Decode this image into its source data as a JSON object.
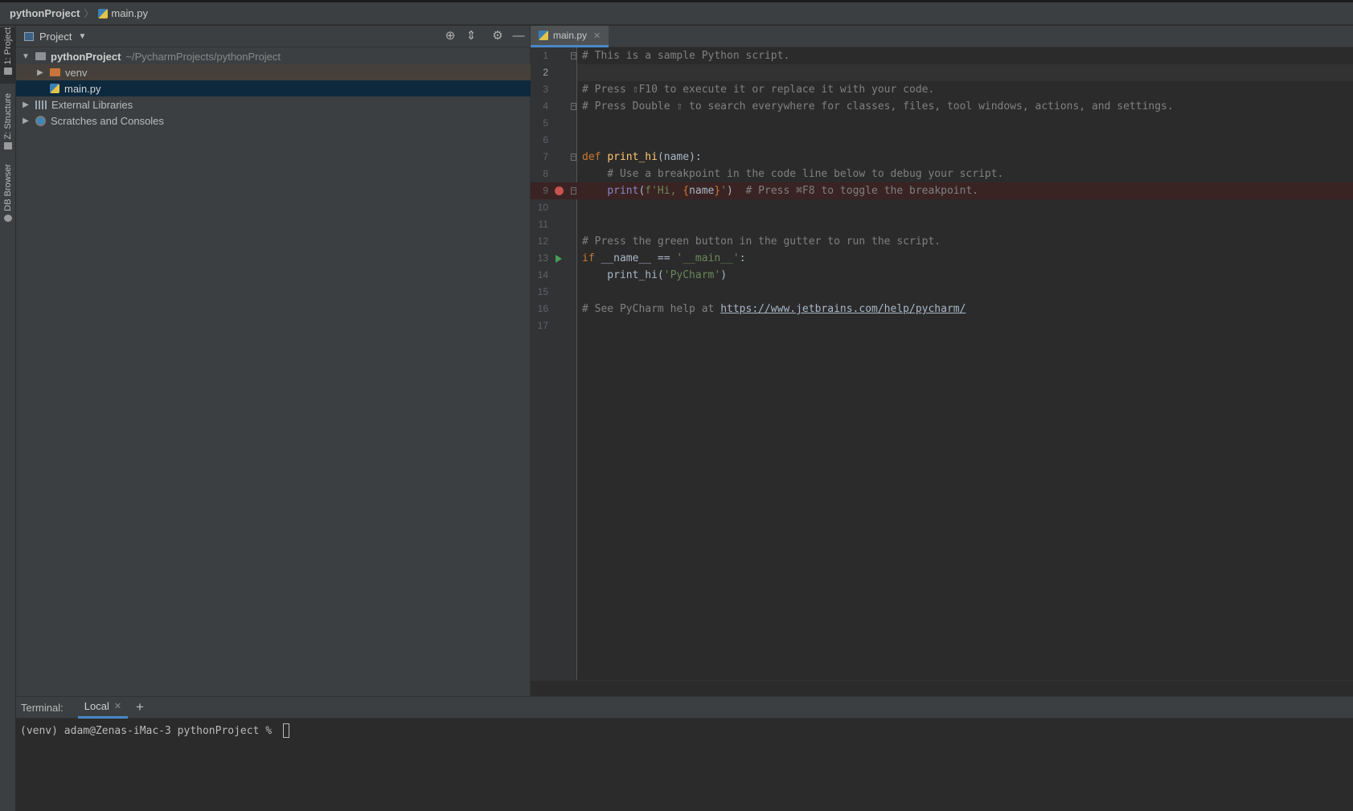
{
  "breadcrumb": {
    "project": "pythonProject",
    "file": "main.py"
  },
  "left_stripe": {
    "tabs": [
      {
        "label": "1: Project",
        "active": true
      },
      {
        "label": "Z: Structure",
        "active": false
      },
      {
        "label": "DB Browser",
        "active": false
      }
    ]
  },
  "project_panel": {
    "title": "Project",
    "tree": [
      {
        "label": "pythonProject",
        "path": "~/PycharmProjects/pythonProject",
        "expanded": true
      },
      {
        "label": "venv",
        "expanded": false
      },
      {
        "label": "main.py",
        "selected": true
      },
      {
        "label": "External Libraries",
        "expanded": false
      },
      {
        "label": "Scratches and Consoles",
        "expanded": false
      }
    ]
  },
  "editor": {
    "tab_label": "main.py",
    "current_line": 2,
    "breakpoint_line": 9,
    "run_marker_line": 13,
    "line_numbers": [
      "1",
      "2",
      "3",
      "4",
      "5",
      "6",
      "7",
      "8",
      "9",
      "10",
      "11",
      "12",
      "13",
      "14",
      "15",
      "16",
      "17"
    ],
    "code": {
      "l1": "# This is a sample Python script.",
      "l3": "# Press ⇧F10 to execute it or replace it with your code.",
      "l4": "# Press Double ⇧ to search everywhere for classes, files, tool windows, actions, and settings.",
      "l7_kw": "def",
      "l7_fn": "print_hi",
      "l7_rest": "(name):",
      "l8": "    # Use a breakpoint in the code line below to debug your script.",
      "l9_indent": "    ",
      "l9_fn": "print",
      "l9_open": "(",
      "l9_str1": "f'Hi, ",
      "l9_brace1": "{",
      "l9_name": "name",
      "l9_brace2": "}",
      "l9_str2": "'",
      "l9_close": ")",
      "l9_comment": "  # Press ⌘F8 to toggle the breakpoint.",
      "l12": "# Press the green button in the gutter to run the script.",
      "l13_kw": "if",
      "l13_mid": " __name__ == ",
      "l13_str": "'__main__'",
      "l13_end": ":",
      "l14_pre": "    print_hi(",
      "l14_str": "'PyCharm'",
      "l14_end": ")",
      "l16_pre": "# See PyCharm help at ",
      "l16_link": "https://www.jetbrains.com/help/pycharm/"
    }
  },
  "terminal": {
    "label": "Terminal:",
    "tab": "Local",
    "add": "+",
    "prompt": "(venv) adam@Zenas-iMac-3 pythonProject % "
  },
  "colors": {
    "accent": "#4a88c7",
    "breakpoint": "#c75450",
    "run": "#499c54"
  }
}
